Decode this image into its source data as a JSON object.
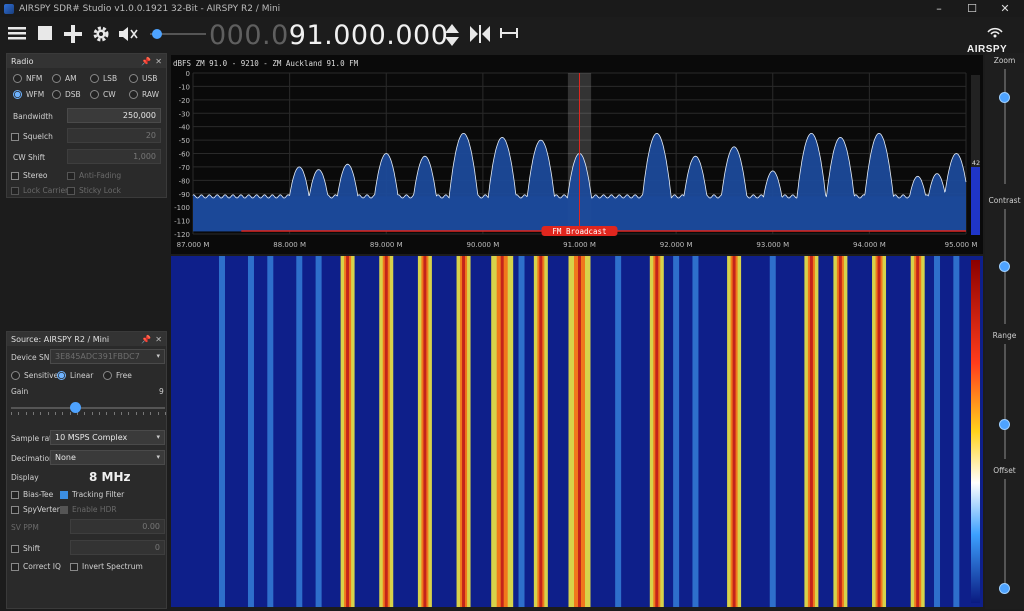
{
  "window": {
    "title": "AIRSPY SDR# Studio v1.0.0.1921 32-Bit - AIRSPY R2 / Mini",
    "controls": [
      "–",
      "☐",
      "✕"
    ]
  },
  "toolbar": {
    "freq_dim": "000.0",
    "freq_bright": "91.000.000",
    "logo": "AIRSPY",
    "volume_level": 0.05
  },
  "radio_panel": {
    "title": "Radio",
    "modes": [
      {
        "label": "NFM",
        "selected": false
      },
      {
        "label": "AM",
        "selected": false
      },
      {
        "label": "LSB",
        "selected": false
      },
      {
        "label": "USB",
        "selected": false
      },
      {
        "label": "WFM",
        "selected": true
      },
      {
        "label": "DSB",
        "selected": false
      },
      {
        "label": "CW",
        "selected": false
      },
      {
        "label": "RAW",
        "selected": false
      }
    ],
    "bandwidth_label": "Bandwidth",
    "bandwidth_value": "250,000",
    "squelch_label": "Squelch",
    "squelch_value": "20",
    "cwshift_label": "CW Shift",
    "cwshift_value": "1,000",
    "stereo_label": "Stereo",
    "antifading_label": "Anti-Fading",
    "lockcarrier_label": "Lock Carrier",
    "stickylock_label": "Sticky Lock"
  },
  "source_panel": {
    "title": "Source: AIRSPY R2 / Mini",
    "device_sn_label": "Device SN",
    "device_sn_value": "3E845ADC391FBDC7",
    "gain_modes": [
      {
        "label": "Sensitive",
        "selected": false
      },
      {
        "label": "Linear",
        "selected": true
      },
      {
        "label": "Free",
        "selected": false
      }
    ],
    "gain_label": "Gain",
    "gain_value": "9",
    "gain_level": 0.41,
    "samplerate_label": "Sample rate",
    "samplerate_value": "10 MSPS Complex",
    "decimation_label": "Decimation",
    "decimation_value": "None",
    "display_label": "Display",
    "display_value": "8 MHz",
    "biastee_label": "Bias-Tee",
    "trackingfilter_label": "Tracking Filter",
    "spyverter_label": "SpyVerter",
    "enablehdr_label": "Enable HDR",
    "svppm_label": "SV PPM",
    "svppm_value": "0.00",
    "shift_label": "Shift",
    "shift_value": "0",
    "correctiq_label": "Correct IQ",
    "invertspectrum_label": "Invert Spectrum"
  },
  "spectrum": {
    "header": "dBFS  ZM 91.0  - 9210 - ZM Auckland 91.0 FM",
    "y_ticks": [
      "0",
      "-10",
      "-20",
      "-30",
      "-40",
      "-50",
      "-60",
      "-70",
      "-80",
      "-90",
      "-100",
      "-110",
      "-120"
    ],
    "x_ticks": [
      "87.000 M",
      "88.000 M",
      "89.000 M",
      "90.000 M",
      "91.000 M",
      "92.000 M",
      "93.000 M",
      "94.000 M",
      "95.000 M"
    ],
    "band_label": "FM Broadcast",
    "level_readout": "42",
    "colors": {
      "fill": "#1c4a9a",
      "line": "#e6eef8",
      "band": "#e0261e",
      "background": "#0a0a0a"
    }
  },
  "right_sliders": [
    {
      "label": "Zoom",
      "level": 0.22
    },
    {
      "label": "Contrast",
      "level": 0.5
    },
    {
      "label": "Range",
      "level": 0.72
    },
    {
      "label": "Offset",
      "level": 1.0
    }
  ]
}
